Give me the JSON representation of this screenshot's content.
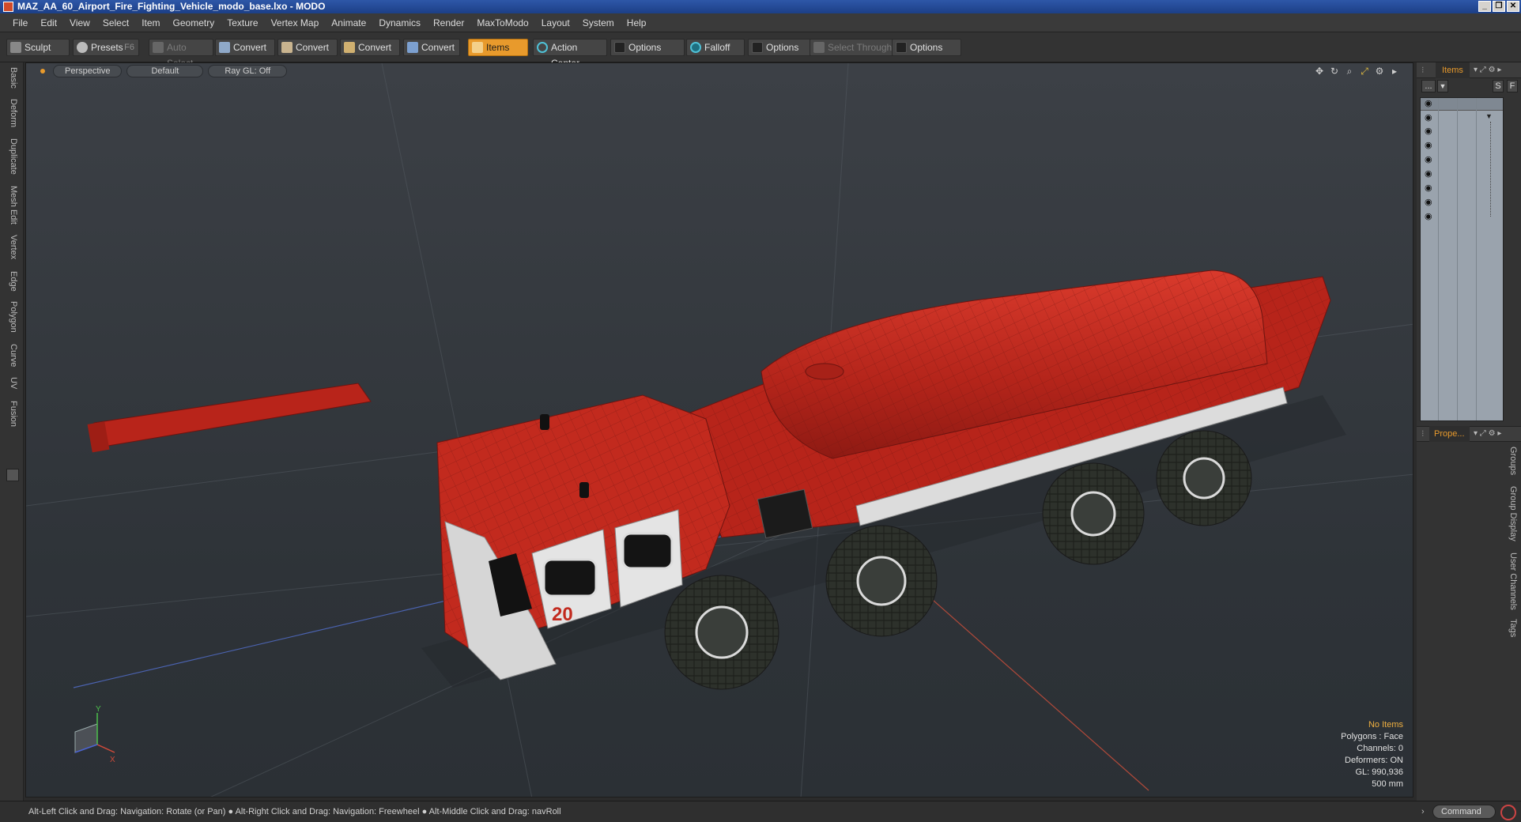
{
  "window": {
    "title": "MAZ_AA_60_Airport_Fire_Fighting_Vehicle_modo_base.lxo - MODO"
  },
  "menu": [
    "File",
    "Edit",
    "View",
    "Select",
    "Item",
    "Geometry",
    "Texture",
    "Vertex Map",
    "Animate",
    "Dynamics",
    "Render",
    "MaxToModo",
    "Layout",
    "System",
    "Help"
  ],
  "toolbar": {
    "sculpt": "Sculpt",
    "presets": "Presets",
    "presets_key": "F6",
    "auto_select": "Auto Select",
    "convert1": "Convert",
    "convert2": "Convert",
    "convert3": "Convert",
    "convert4": "Convert",
    "items": "Items",
    "action_center": "Action Center",
    "options1": "Options",
    "falloff": "Falloff",
    "options2": "Options",
    "select_through": "Select Through",
    "options3": "Options"
  },
  "left_tabs": [
    "Basic",
    "Deform",
    "Duplicate",
    "Mesh Edit",
    "Vertex",
    "Edge",
    "Polygon",
    "Curve",
    "UV",
    "Fusion"
  ],
  "viewport": {
    "view": "Perspective",
    "shading": "Default",
    "raygl": "Ray GL: Off",
    "truck_number": "20",
    "info": {
      "selection": "No Items",
      "polygons": "Polygons : Face",
      "channels": "Channels: 0",
      "deformers": "Deformers: ON",
      "gl": "GL: 990,936",
      "scale": "500 mm"
    },
    "axis": {
      "y": "Y",
      "x": "X"
    }
  },
  "right_panel": {
    "items_tab": "Items",
    "props_tab": "Prope...",
    "dots": "...",
    "s_btn": "S",
    "f_btn": "F",
    "side_tabs": [
      "Groups",
      "Group Display",
      "User Channels",
      "Tags"
    ]
  },
  "status": {
    "hint": "Alt-Left Click and Drag: Navigation: Rotate (or Pan) ●  Alt-Right Click and Drag: Navigation: Freewheel ●  Alt-Middle Click and Drag: navRoll",
    "command_placeholder": "Command"
  },
  "colors": {
    "accent": "#e89a2c",
    "truck_red": "#c4231a",
    "viewport_bg": "#2f3439"
  }
}
